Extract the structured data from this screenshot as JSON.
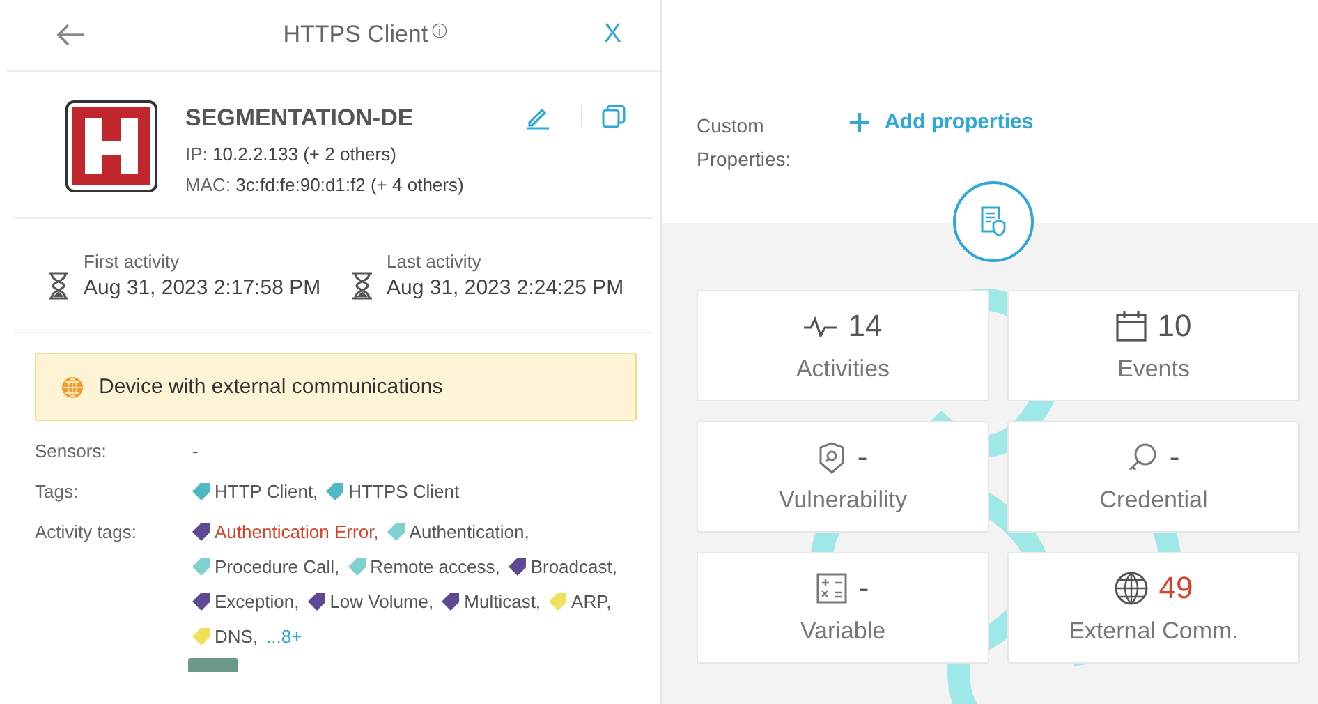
{
  "header": {
    "title": "HTTPS Client",
    "info_icon": "ⓘ",
    "close": "X"
  },
  "device": {
    "name": "SEGMENTATION-DE",
    "ip_label": "IP:",
    "ip": "10.2.2.133 (+ 2 others)",
    "mac_label": "MAC:",
    "mac": "3c:fd:fe:90:d1:f2 (+ 4 others)"
  },
  "activity": [
    {
      "label": "First activity",
      "value": "Aug 31, 2023 2:17:58 PM"
    },
    {
      "label": "Last activity",
      "value": "Aug 31, 2023 2:24:25 PM"
    }
  ],
  "alert": {
    "text": "Device with external communications"
  },
  "sensors": {
    "label": "Sensors:",
    "value": "-"
  },
  "tags": {
    "label": "Tags:",
    "items": [
      {
        "text": "HTTP Client,",
        "color": "#4fb8c4",
        "error": false
      },
      {
        "text": "HTTPS Client",
        "color": "#4fb8c4",
        "error": false
      }
    ]
  },
  "activity_tags": {
    "label": "Activity tags:",
    "more": "...8+",
    "items": [
      {
        "text": "Authentication Error,",
        "color": "#5e4a94",
        "error": true
      },
      {
        "text": "Authentication,",
        "color": "#7fd0d0",
        "error": false
      },
      {
        "text": "Procedure Call,",
        "color": "#7fd0d0",
        "error": false
      },
      {
        "text": "Remote access,",
        "color": "#7fd0d0",
        "error": false
      },
      {
        "text": "Broadcast,",
        "color": "#5e4a94",
        "error": false
      },
      {
        "text": "Exception,",
        "color": "#5e4a94",
        "error": false
      },
      {
        "text": "Low Volume,",
        "color": "#5e4a94",
        "error": false
      },
      {
        "text": "Multicast,",
        "color": "#5e4a94",
        "error": false
      },
      {
        "text": "ARP,",
        "color": "#f0e15a",
        "error": false
      },
      {
        "text": "DNS,",
        "color": "#f0e15a",
        "error": false
      }
    ]
  },
  "custom_properties": {
    "label": "Custom Properties:",
    "add": "Add properties"
  },
  "stats": [
    {
      "kind": "activity",
      "value": "14",
      "label": "Activities",
      "alert": false
    },
    {
      "kind": "calendar",
      "value": "10",
      "label": "Events",
      "alert": false
    },
    {
      "kind": "shield",
      "value": "-",
      "label": "Vulnerability",
      "alert": false
    },
    {
      "kind": "key",
      "value": "-",
      "label": "Credential",
      "alert": false
    },
    {
      "kind": "variable",
      "value": "-",
      "label": "Variable",
      "alert": false
    },
    {
      "kind": "globe",
      "value": "49",
      "label": "External Comm.",
      "alert": true
    }
  ]
}
